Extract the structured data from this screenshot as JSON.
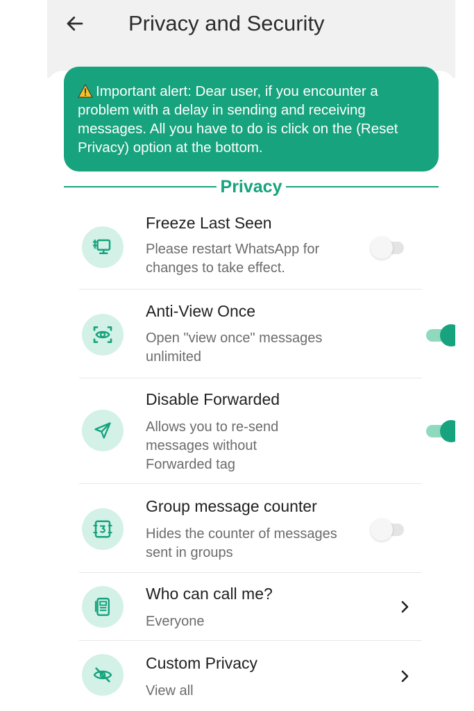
{
  "appbar": {
    "title": "Privacy and Security",
    "back_icon": "arrow-back-icon"
  },
  "alert": {
    "icon": "warning-icon",
    "text": "Important alert: Dear user, if you encounter a problem with a delay in sending and receiving messages. All you have to do is click on the (Reset Privacy) option at the bottom."
  },
  "section": {
    "title": "Privacy"
  },
  "items": [
    {
      "title": "Freeze Last Seen",
      "subtitle": "Please restart WhatsApp for changes to take effect.",
      "control": "toggle",
      "enabled": false,
      "icon": "desktop-freeze-icon"
    },
    {
      "title": "Anti-View Once",
      "subtitle": "Open \"view once\" messages unlimited",
      "control": "toggle",
      "enabled": true,
      "icon": "eye-scan-icon"
    },
    {
      "title": "Disable Forwarded",
      "subtitle": "Allows you to re-send messages without Forwarded tag",
      "control": "toggle",
      "enabled": true,
      "icon": "send-icon"
    },
    {
      "title": "Group message counter",
      "subtitle": "Hides the counter of messages sent in groups",
      "control": "toggle",
      "enabled": false,
      "icon": "counter-icon"
    },
    {
      "title": "Who can call me?",
      "subtitle": "Everyone",
      "control": "chevron",
      "icon": "phone-icon"
    },
    {
      "title": "Custom Privacy",
      "subtitle": "View all",
      "control": "chevron",
      "icon": "eye-off-icon"
    }
  ],
  "colors": {
    "accent": "#16a37d",
    "icon_bg": "#d3f1e7",
    "appbar_bg": "#f1f1f1"
  }
}
